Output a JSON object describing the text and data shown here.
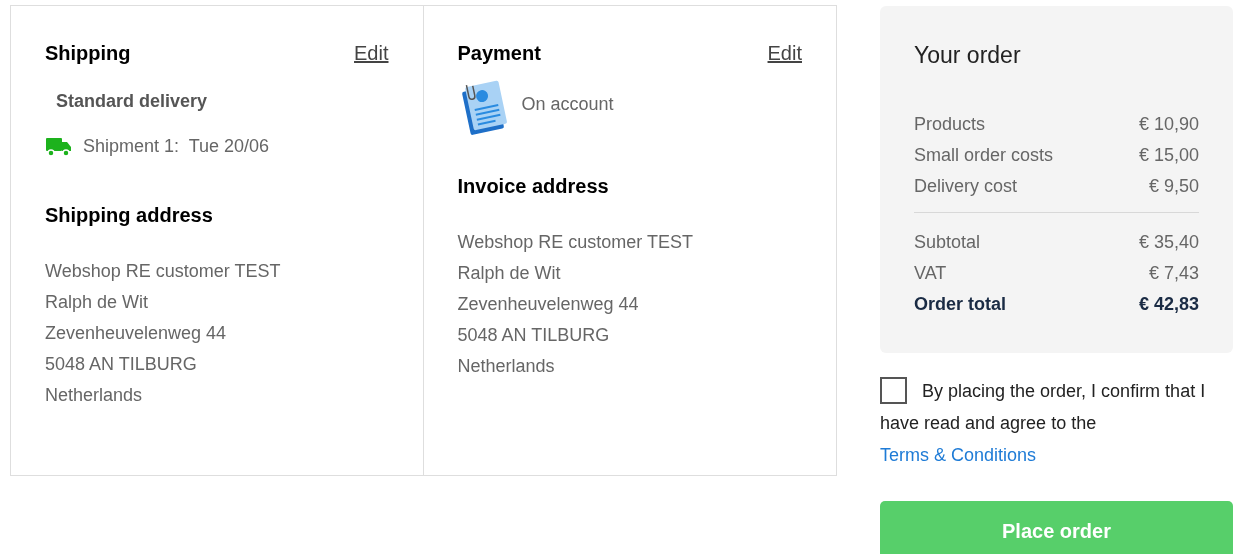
{
  "shipping": {
    "title": "Shipping",
    "edit": "Edit",
    "method": "Standard delivery",
    "shipment": "Shipment 1:  Tue 20/06"
  },
  "payment": {
    "title": "Payment",
    "edit": "Edit",
    "method": "On account"
  },
  "shipping_address": {
    "title": "Shipping address",
    "lines": [
      "Webshop RE customer TEST",
      "Ralph de Wit",
      "Zevenheuvelenweg 44",
      "5048 AN TILBURG",
      "Netherlands"
    ]
  },
  "invoice_address": {
    "title": "Invoice address",
    "lines": [
      "Webshop RE customer TEST",
      "Ralph de Wit",
      "Zevenheuvelenweg 44",
      "5048 AN TILBURG",
      "Netherlands"
    ]
  },
  "order": {
    "title": "Your order",
    "costs": [
      {
        "label": "Products",
        "value": "€ 10,90"
      },
      {
        "label": "Small order costs",
        "value": "€ 15,00"
      },
      {
        "label": "Delivery cost",
        "value": "€ 9,50"
      }
    ],
    "totals": [
      {
        "label": "Subtotal",
        "value": "€ 35,40",
        "kind": "line"
      },
      {
        "label": "VAT",
        "value": "€ 7,43",
        "kind": "line"
      },
      {
        "label": "Order total",
        "value": "€ 42,83",
        "kind": "total"
      }
    ]
  },
  "terms": {
    "checked": false,
    "text": "By placing the order, I confirm that I have read and agree to the",
    "link": "Terms & Conditions"
  },
  "place_order": "Place order"
}
